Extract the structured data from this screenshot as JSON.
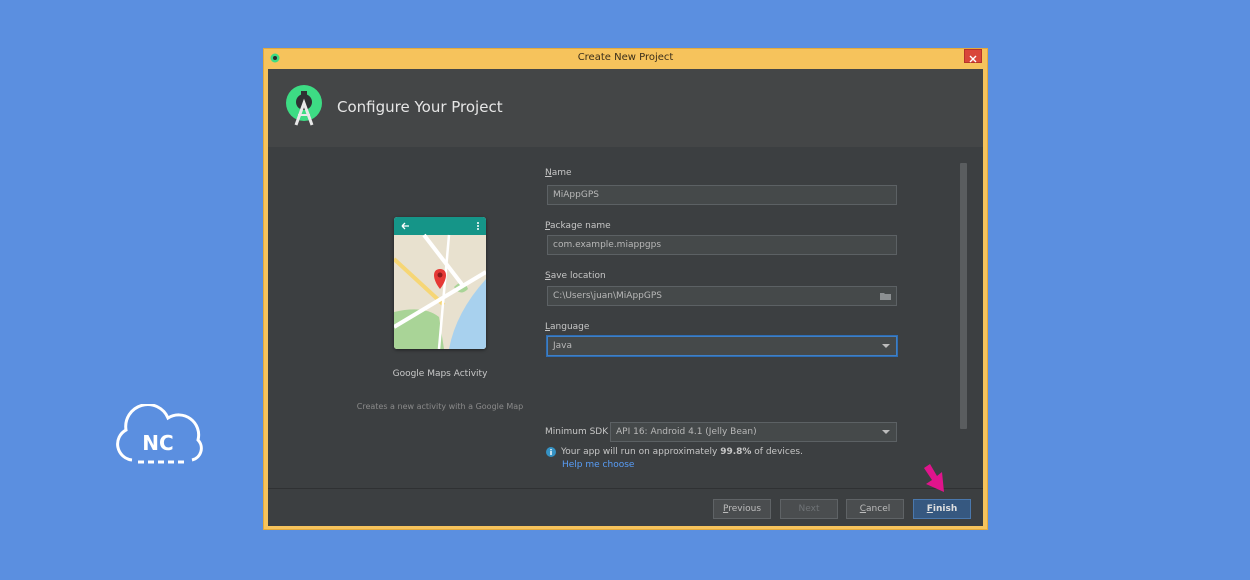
{
  "window": {
    "title": "Create New Project"
  },
  "header": {
    "title": "Configure Your Project"
  },
  "activity": {
    "name": "Google Maps Activity",
    "description": "Creates a new activity with a Google Map"
  },
  "form": {
    "name": {
      "label_mnemonic": "N",
      "label_rest": "ame",
      "value": "MiAppGPS"
    },
    "package": {
      "label_mnemonic": "P",
      "label_rest": "ackage name",
      "value": "com.example.miappgps"
    },
    "save_location": {
      "label_mnemonic": "S",
      "label_rest": "ave location",
      "value": "C:\\Users\\juan\\MiAppGPS"
    },
    "language": {
      "label_mnemonic": "L",
      "label_rest": "anguage",
      "value": "Java"
    },
    "min_sdk": {
      "label": "Minimum SDK",
      "value": "API 16: Android 4.1 (Jelly Bean)"
    },
    "info": {
      "prefix": "Your app will run on approximately ",
      "percent": "99.8%",
      "suffix": " of devices."
    },
    "help_link": "Help me choose"
  },
  "buttons": {
    "previous": {
      "mnemonic": "P",
      "rest": "revious"
    },
    "next": "Next",
    "cancel": {
      "mnemonic": "C",
      "rest": "ancel"
    },
    "finish": {
      "mnemonic": "F",
      "rest": "inish"
    }
  },
  "logo": {
    "text": "NC"
  },
  "colors": {
    "background": "#5b8fe0",
    "window_frame": "#f6c35c",
    "accent": "#3f7fc4",
    "pointer": "#e0148c",
    "android_green": "#3ddc84"
  }
}
